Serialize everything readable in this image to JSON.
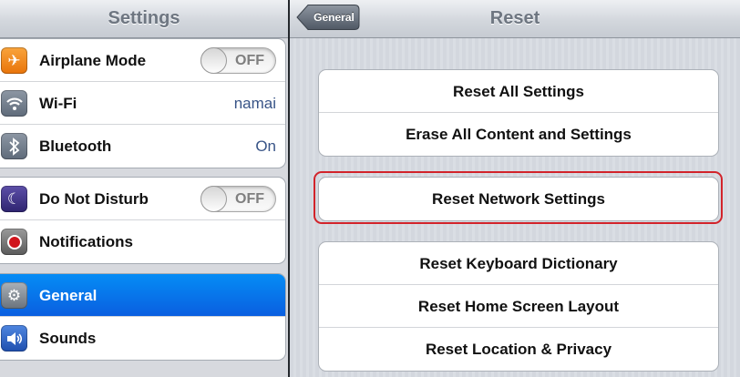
{
  "left": {
    "title": "Settings",
    "groups": [
      [
        {
          "label": "Airplane Mode",
          "icon": "airplane-icon",
          "icon_color": "#f4880f",
          "toggle": "OFF"
        },
        {
          "label": "Wi-Fi",
          "icon": "wifi-icon",
          "icon_color": "#4a76c9",
          "value": "namai"
        },
        {
          "label": "Bluetooth",
          "icon": "bluetooth-icon",
          "icon_color": "#4a76c9",
          "value": "On"
        }
      ],
      [
        {
          "label": "Do Not Disturb",
          "icon": "moon-icon",
          "icon_color": "#4b3a8c",
          "toggle": "OFF"
        },
        {
          "label": "Notifications",
          "icon": "notifications-icon",
          "icon_color": "#7b7b7b"
        }
      ],
      [
        {
          "label": "General",
          "icon": "gear-icon",
          "icon_color": "#808890",
          "selected": true
        },
        {
          "label": "Sounds",
          "icon": "speaker-icon",
          "icon_color": "#2f66c8"
        }
      ]
    ]
  },
  "right": {
    "title": "Reset",
    "back_label": "General",
    "groups": [
      [
        "Reset All Settings",
        "Erase All Content and Settings"
      ],
      [
        "Reset Network Settings"
      ],
      [
        "Reset Keyboard Dictionary",
        "Reset Home Screen Layout",
        "Reset Location & Privacy"
      ]
    ],
    "highlight_color": "#d2232a"
  },
  "colors": {
    "selected_row": "#0a6fe8",
    "detail_value": "#385487"
  }
}
